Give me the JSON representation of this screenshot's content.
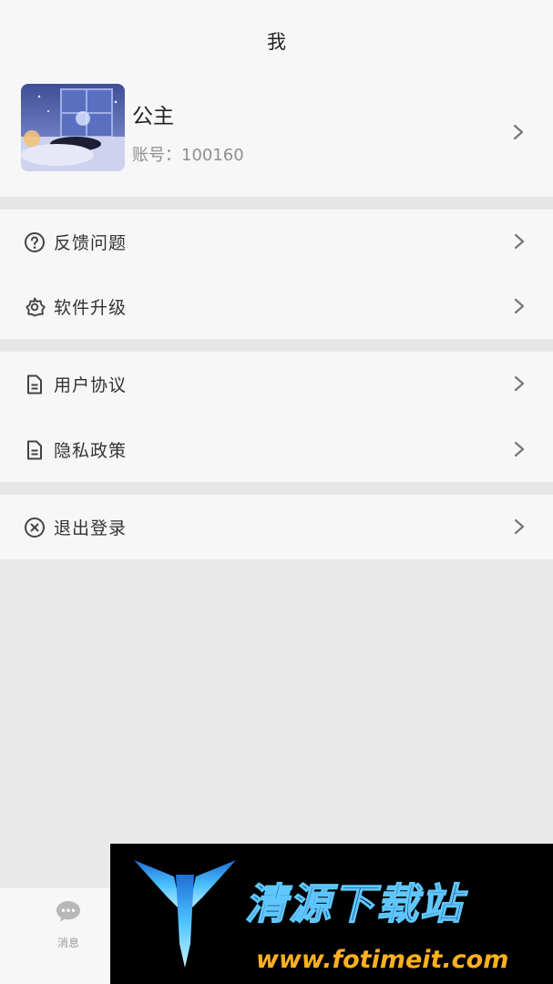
{
  "header": {
    "title": "我"
  },
  "profile": {
    "name": "公主",
    "account": "账号：100160",
    "avatar_icon": "avatar-night-illustration"
  },
  "menu_groups": [
    [
      {
        "label": "反馈问题",
        "icon": "question-circle-icon"
      },
      {
        "label": "软件升级",
        "icon": "flower-gear-icon"
      }
    ],
    [
      {
        "label": "用户协议",
        "icon": "document-icon"
      },
      {
        "label": "隐私政策",
        "icon": "document-icon"
      }
    ],
    [
      {
        "label": "退出登录",
        "icon": "close-circle-icon"
      }
    ]
  ],
  "tabbar": {
    "messages_label": "消息",
    "messages_icon": "chat-bubble-icon"
  },
  "watermark": {
    "title": "清源下载站",
    "url": "www.fotimeit.com"
  },
  "colors": {
    "background": "#e9e9e9",
    "card": "#f7f7f7",
    "secondary_text": "#8f8f8f",
    "watermark_orange": "#ffb020",
    "watermark_blue": "#5fc7ff"
  }
}
